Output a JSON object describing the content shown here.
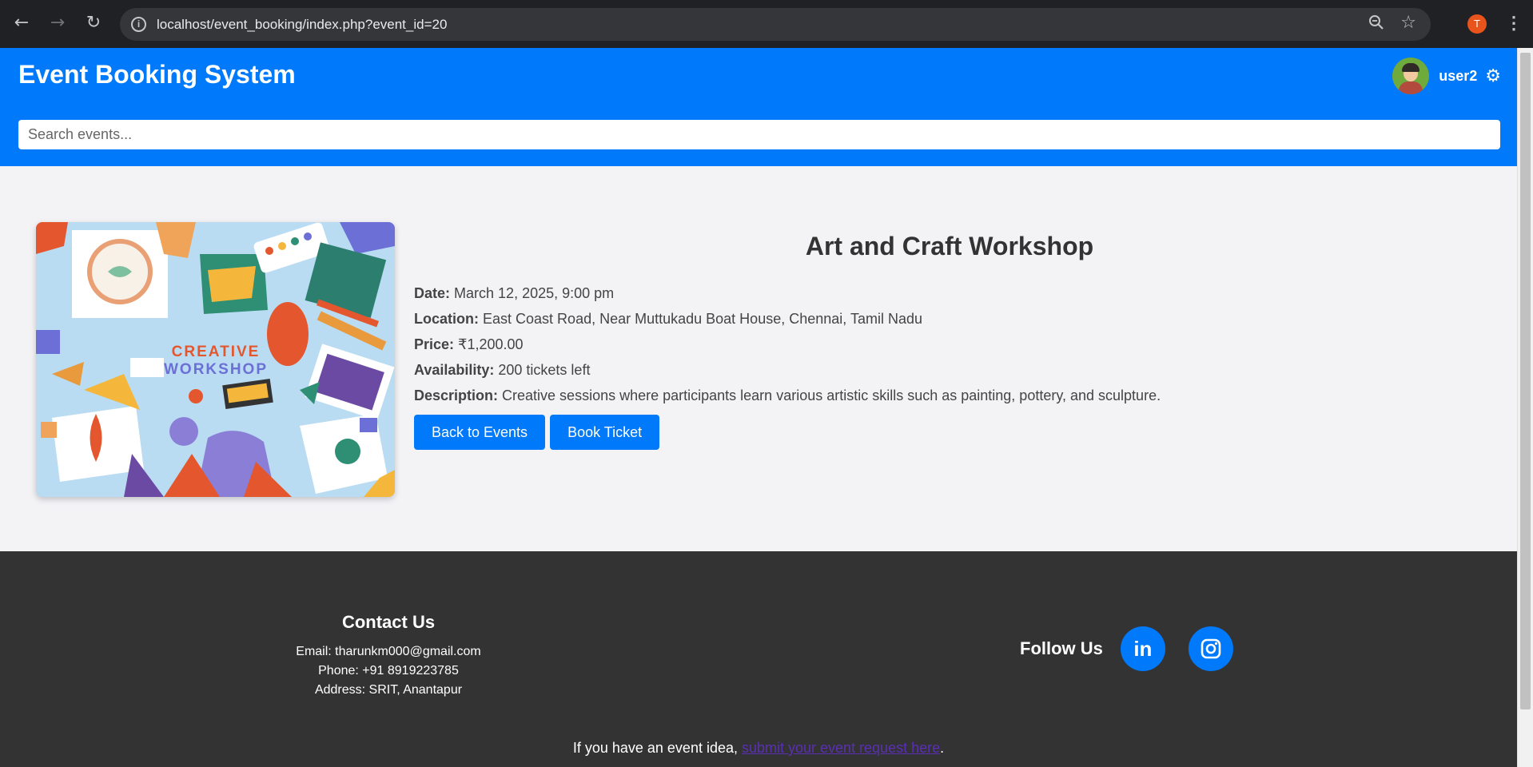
{
  "browser": {
    "url": "localhost/event_booking/index.php?event_id=20",
    "profile_initial": "T",
    "menu_glyph": "⋮"
  },
  "header": {
    "title": "Event Booking System",
    "username": "user2",
    "search_placeholder": "Search events..."
  },
  "event": {
    "title": "Art and Craft Workshop",
    "image_text_line1": "CREATIVE",
    "image_text_line2": "WORKSHOP",
    "date_label": "Date:",
    "date": "March 12, 2025, 9:00 pm",
    "location_label": "Location:",
    "location": "East Coast Road, Near Muttukadu Boat House, Chennai, Tamil Nadu",
    "price_label": "Price:",
    "price": "₹1,200.00",
    "availability_label": "Availability:",
    "availability": "200 tickets left",
    "description_label": "Description:",
    "description": "Creative sessions where participants learn various artistic skills such as painting, pottery, and sculpture.",
    "back_button": "Back to Events",
    "book_button": "Book Ticket"
  },
  "footer": {
    "contact_title": "Contact Us",
    "email": "Email: tharunkm000@gmail.com",
    "phone": "Phone: +91 8919223785",
    "address": "Address: SRIT, Anantapur",
    "follow_title": "Follow Us",
    "linkedin_text": "in",
    "idea_text": "If you have an event idea, ",
    "idea_link": "submit your event request here",
    "idea_end": "."
  },
  "colors": {
    "primary": "#0079fb",
    "footer_bg": "#333333",
    "page_bg": "#f3f3f6"
  }
}
